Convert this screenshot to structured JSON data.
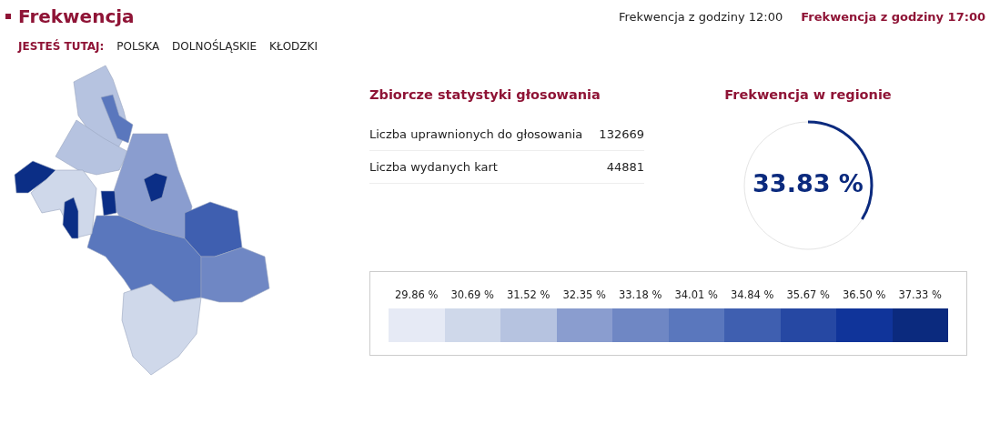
{
  "title": "Frekwencja",
  "periods": [
    {
      "label": "Frekwencja z godziny 12:00",
      "selected": false
    },
    {
      "label": "Frekwencja z godziny 17:00",
      "selected": true
    }
  ],
  "breadcrumb": {
    "label": "JESTEŚ TUTAJ:",
    "items": [
      "POLSKA",
      "DOLNOŚLĄSKIE",
      "KŁODZKI"
    ]
  },
  "stats": {
    "title": "Zbiorcze statystyki głosowania",
    "rows": [
      {
        "label": "Liczba uprawnionych do głosowania",
        "value": "132669"
      },
      {
        "label": "Liczba wydanych kart",
        "value": "44881"
      }
    ]
  },
  "turnout": {
    "title": "Frekwencja w regionie",
    "value": "33.83 %",
    "level": 0.3383
  },
  "legend": [
    {
      "label": "29.86 %",
      "color": "#e6eaf5"
    },
    {
      "label": "30.69 %",
      "color": "#cfd8ea"
    },
    {
      "label": "31.52 %",
      "color": "#b6c3e0"
    },
    {
      "label": "32.35 %",
      "color": "#8a9dcf"
    },
    {
      "label": "33.18 %",
      "color": "#6f87c4"
    },
    {
      "label": "34.01 %",
      "color": "#5a77bd"
    },
    {
      "label": "34.84 %",
      "color": "#3f5fb0"
    },
    {
      "label": "35.67 %",
      "color": "#2648a3"
    },
    {
      "label": "36.50 %",
      "color": "#10349a"
    },
    {
      "label": "37.33 %",
      "color": "#0b2a7e"
    }
  ]
}
